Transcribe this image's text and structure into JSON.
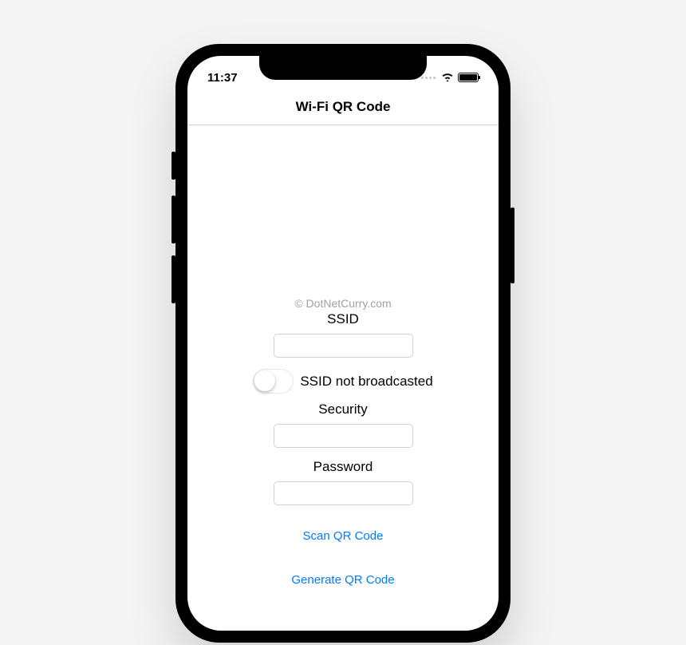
{
  "statusBar": {
    "time": "11:37"
  },
  "navBar": {
    "title": "Wi-Fi QR Code"
  },
  "watermark": "© DotNetCurry.com",
  "form": {
    "ssidLabel": "SSID",
    "ssidValue": "",
    "toggleLabel": "SSID not broadcasted",
    "securityLabel": "Security",
    "securityValue": "",
    "passwordLabel": "Password",
    "passwordValue": ""
  },
  "actions": {
    "scan": "Scan QR Code",
    "generate": "Generate QR Code"
  }
}
